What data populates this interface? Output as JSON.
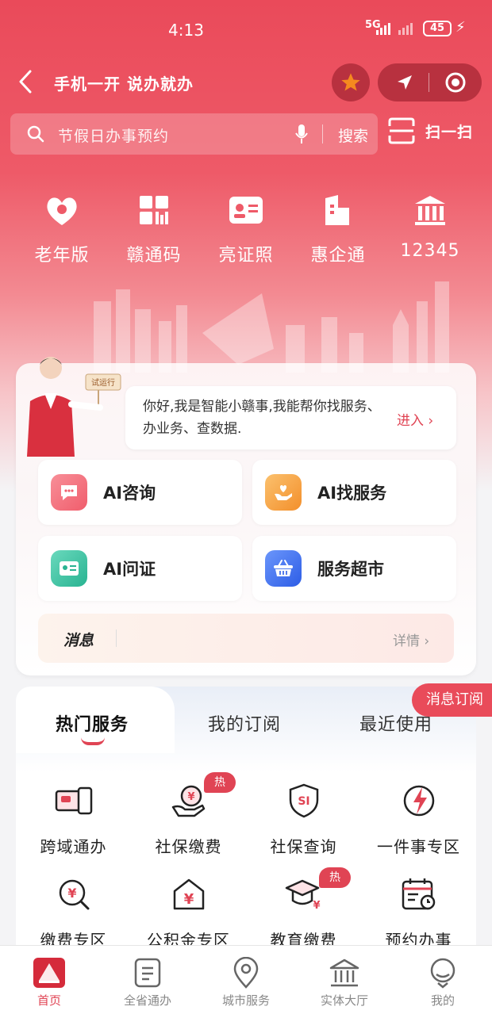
{
  "status_bar": {
    "time": "4:13",
    "network": "5G",
    "battery": "45"
  },
  "header": {
    "title": "手机一开 说办就办"
  },
  "search": {
    "placeholder": "节假日办事预约",
    "button": "搜索",
    "scan": "扫一扫"
  },
  "quick": [
    {
      "label": "老年版",
      "icon": "heart-hands-icon"
    },
    {
      "label": "赣通码",
      "icon": "qr-code-icon"
    },
    {
      "label": "亮证照",
      "icon": "id-card-icon"
    },
    {
      "label": "惠企通",
      "icon": "building-icon"
    },
    {
      "label": "12345",
      "icon": "government-building-icon"
    }
  ],
  "assistant": {
    "badge": "试运行",
    "greeting": "你好,我是智能小赣事,我能帮你找服务、办业务、查数据.",
    "enter": "进入",
    "tiles": [
      {
        "label": "AI咨询",
        "icon": "chat-icon",
        "color": "#f26d7a"
      },
      {
        "label": "AI找服务",
        "icon": "heart-hand-icon",
        "color": "#f7a245"
      },
      {
        "label": "AI问证",
        "icon": "card-icon",
        "color": "#3fc4a5"
      },
      {
        "label": "服务超市",
        "icon": "basket-icon",
        "color": "#3a6ff0"
      }
    ],
    "message": {
      "title": "消息",
      "detail": "详情"
    }
  },
  "services": {
    "tabs": [
      "热门服务",
      "我的订阅",
      "最近使用"
    ],
    "subscribe": "消息订阅",
    "hot_label": "热",
    "items": [
      {
        "label": "跨域通办",
        "icon": "devices-icon"
      },
      {
        "label": "社保缴费",
        "icon": "yuan-hand-icon"
      },
      {
        "label": "社保查询",
        "icon": "si-shield-icon"
      },
      {
        "label": "一件事专区",
        "icon": "lightning-icon"
      },
      {
        "label": "缴费专区",
        "icon": "yuan-search-icon"
      },
      {
        "label": "公积金专区",
        "icon": "yuan-house-icon"
      },
      {
        "label": "教育缴费",
        "icon": "graduation-cap-icon"
      },
      {
        "label": "预约办事",
        "icon": "calendar-clock-icon"
      }
    ]
  },
  "nav": [
    {
      "label": "首页",
      "icon": "home-logo-icon"
    },
    {
      "label": "全省通办",
      "icon": "document-icon"
    },
    {
      "label": "城市服务",
      "icon": "location-icon"
    },
    {
      "label": "实体大厅",
      "icon": "hall-icon"
    },
    {
      "label": "我的",
      "icon": "user-icon"
    }
  ],
  "colors": {
    "primary": "#e94b5a",
    "accent_star": "#f5891f"
  }
}
